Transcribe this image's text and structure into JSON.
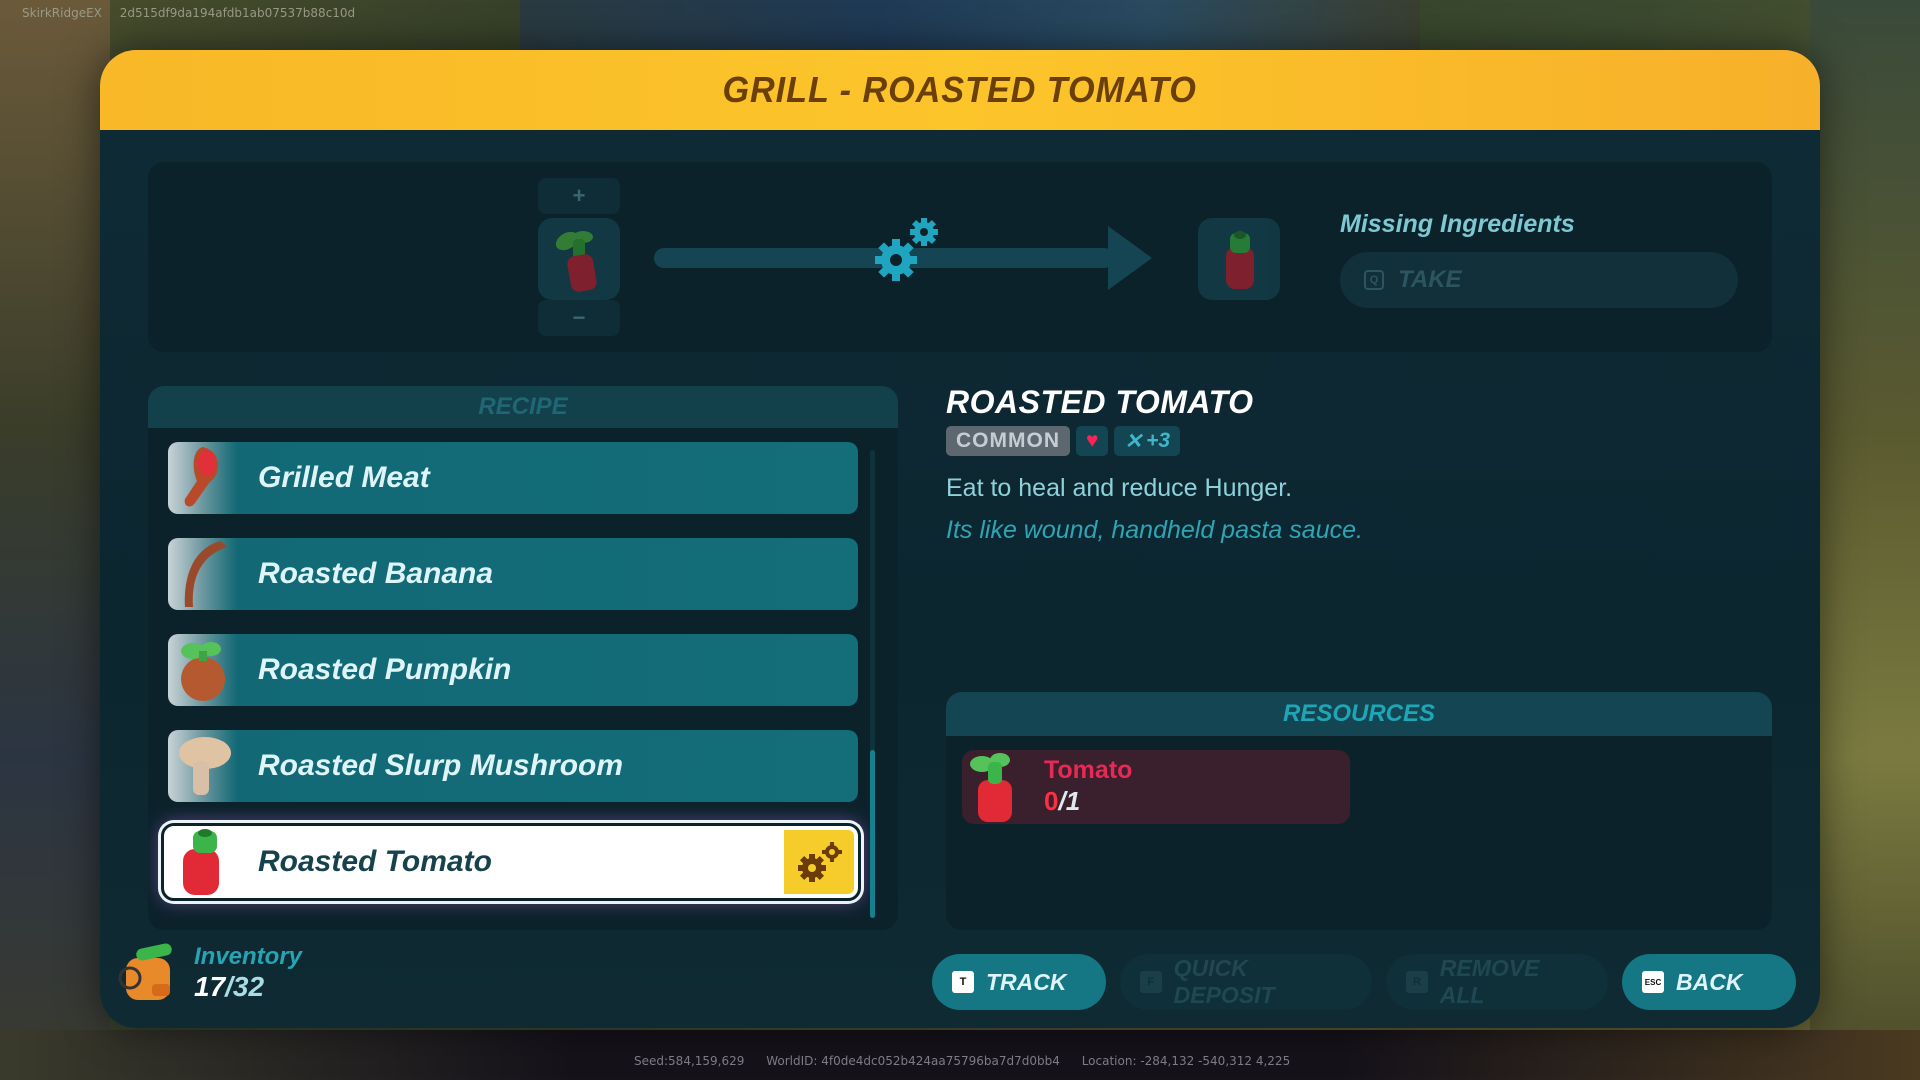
{
  "debug": {
    "top": {
      "user": "SkirkRidgeEX",
      "hash": "2d515df9da194afdb1ab07537b88c10d"
    },
    "bottom": {
      "seed": "Seed:584,159,629",
      "world": "WorldID:   4f0de4dc052b424aa75796ba7d7d0bb4",
      "location": "Location: -284,132  -540,312  4,225"
    }
  },
  "window": {
    "title": "GRILL - ROASTED TOMATO"
  },
  "crafting": {
    "plus": "+",
    "minus": "−",
    "input_item": "Tomato",
    "output_item": "Roasted Tomato",
    "missing_label": "Missing Ingredients",
    "take_label": "TAKE",
    "take_key": "Q"
  },
  "recipe": {
    "header": "RECIPE",
    "items": [
      {
        "label": "Grilled Meat",
        "icon": "grilled-meat-icon",
        "selected": false
      },
      {
        "label": "Roasted Banana",
        "icon": "roasted-banana-icon",
        "selected": false
      },
      {
        "label": "Roasted Pumpkin",
        "icon": "roasted-pumpkin-icon",
        "selected": false
      },
      {
        "label": "Roasted Slurp Mushroom",
        "icon": "roasted-mushroom-icon",
        "selected": false
      },
      {
        "label": "Roasted Tomato",
        "icon": "roasted-tomato-icon",
        "selected": true
      }
    ],
    "scroll_position": 1.0
  },
  "detail": {
    "title": "ROASTED TOMATO",
    "rarity": "COMMON",
    "heart_badge": "♥",
    "food_bonus": "+3",
    "description": "Eat to heal and reduce Hunger.",
    "flavor": "Its like wound, handheld pasta sauce."
  },
  "resources": {
    "header": "RESOURCES",
    "items": [
      {
        "name": "Tomato",
        "have": "0",
        "need": "/1"
      }
    ]
  },
  "inventory": {
    "label": "Inventory",
    "current": "17",
    "max": "/32"
  },
  "buttons": {
    "track": {
      "label": "TRACK",
      "key": "T"
    },
    "quick_deposit": {
      "label": "QUICK DEPOSIT",
      "key": "F"
    },
    "remove_all": {
      "label": "REMOVE ALL",
      "key": "R"
    },
    "back": {
      "label": "BACK",
      "key": "ESC"
    }
  },
  "colors": {
    "title_bar": "#fcc52a",
    "title_text": "#6a3f0a",
    "accent_teal": "#157684",
    "missing_red": "#ff2f3f",
    "craft_tag": "#f6cc2a"
  }
}
